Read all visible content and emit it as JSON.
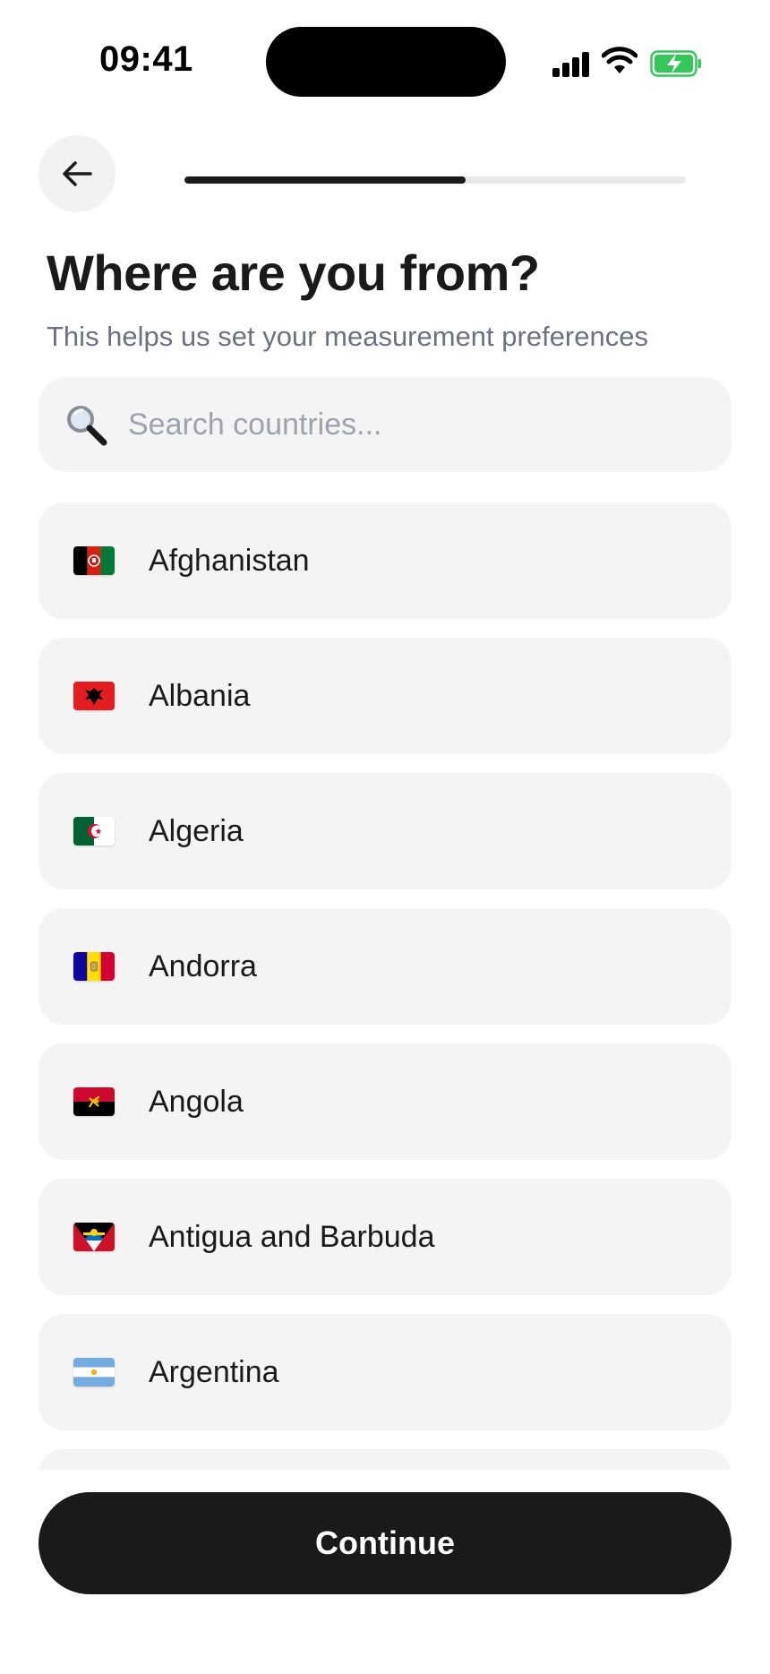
{
  "status_bar": {
    "time": "09:41"
  },
  "header": {
    "progress_fraction": 0.56
  },
  "title": "Where are you from?",
  "subtitle": "This helps us set your measurement preferences",
  "search": {
    "placeholder": "Search countries...",
    "value": ""
  },
  "countries": [
    {
      "name": "Afghanistan",
      "flag_icon": "afghanistan-flag-icon"
    },
    {
      "name": "Albania",
      "flag_icon": "albania-flag-icon"
    },
    {
      "name": "Algeria",
      "flag_icon": "algeria-flag-icon"
    },
    {
      "name": "Andorra",
      "flag_icon": "andorra-flag-icon"
    },
    {
      "name": "Angola",
      "flag_icon": "angola-flag-icon"
    },
    {
      "name": "Antigua and Barbuda",
      "flag_icon": "antigua-and-barbuda-flag-icon"
    },
    {
      "name": "Argentina",
      "flag_icon": "argentina-flag-icon"
    }
  ],
  "continue_label": "Continue",
  "colors": {
    "accent": "#1a1a1a",
    "card_bg": "#f4f4f4",
    "subtitle": "#6b7280",
    "battery": "#34c759"
  }
}
